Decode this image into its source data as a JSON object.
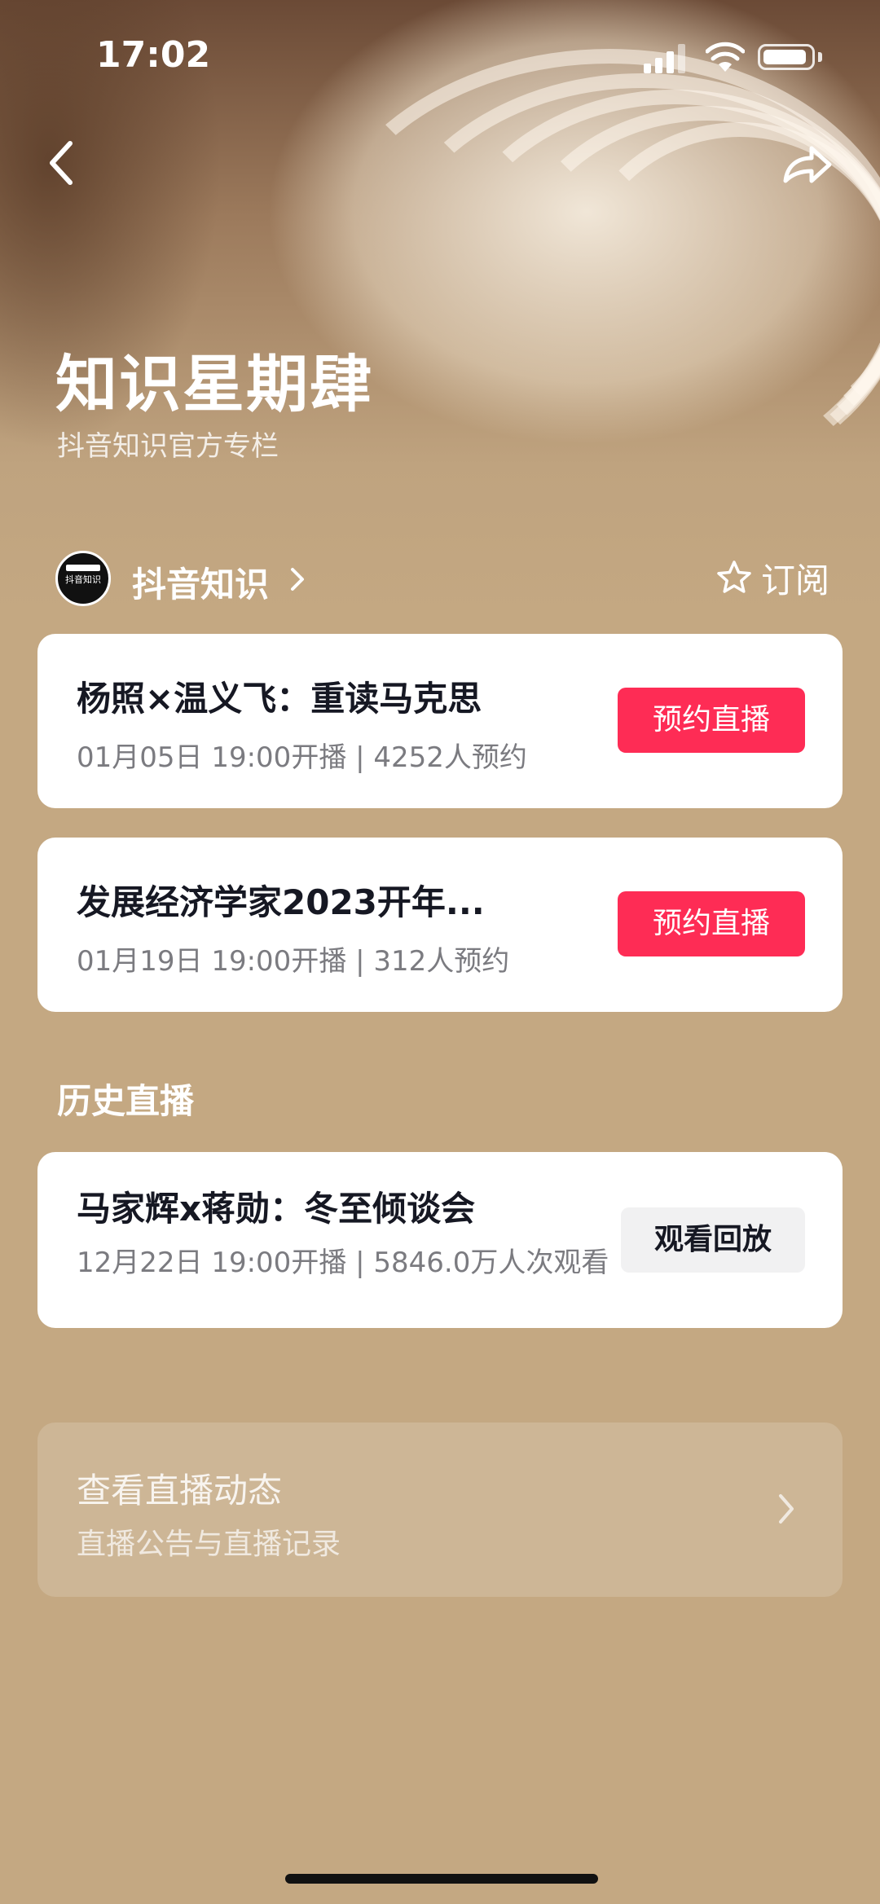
{
  "status_bar": {
    "time": "17:02"
  },
  "header": {
    "title": "知识星期肆",
    "subtitle": "抖音知识官方专栏"
  },
  "author": {
    "name": "抖音知识",
    "avatar_text": "抖音知识",
    "subscribe_label": "订阅"
  },
  "upcoming": [
    {
      "title": "杨照×温义飞：重读马克思",
      "meta": "01月05日 19:00开播 | 4252人预约",
      "button": "预约直播"
    },
    {
      "title": "发展经济学家2023开年...",
      "meta": "01月19日 19:00开播 | 312人预约",
      "button": "预约直播"
    }
  ],
  "history": {
    "heading": "历史直播",
    "items": [
      {
        "title": "马家辉x蒋勋：冬至倾谈会",
        "meta": "12月22日 19:00开播 | 5846.0万人次观看",
        "button": "观看回放"
      }
    ]
  },
  "dynamics": {
    "title": "查看直播动态",
    "subtitle": "直播公告与直播记录"
  },
  "colors": {
    "accent": "#fe2c55",
    "background": "#c4a882",
    "card": "#ffffff"
  }
}
